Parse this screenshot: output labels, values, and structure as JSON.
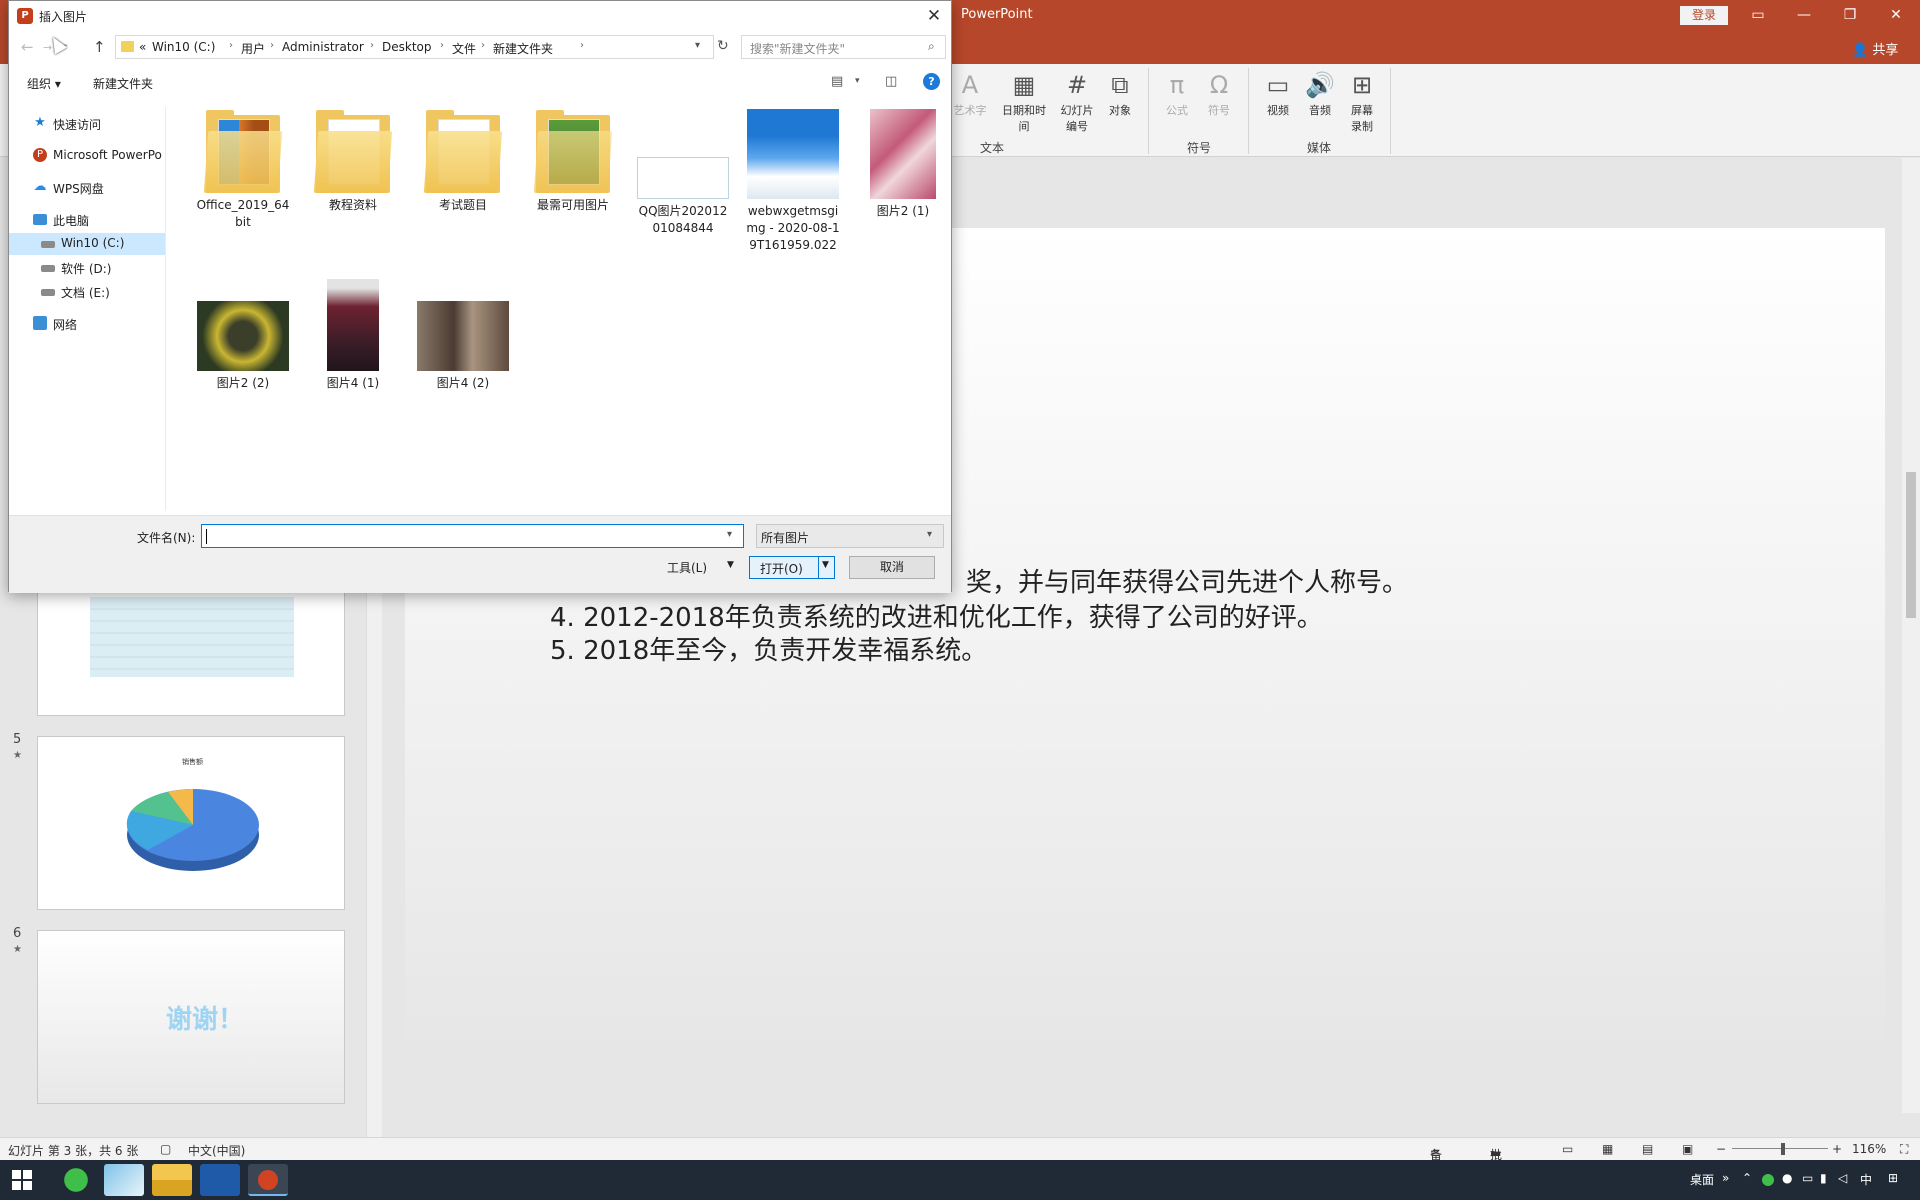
{
  "ppt": {
    "app_title": "PowerPoint",
    "login_label": "登录",
    "share_label": "共享",
    "ribbon": {
      "buttons": [
        {
          "label": "艺术字",
          "icon": "wordart-icon",
          "disabled": true
        },
        {
          "label": "日期和时间",
          "icon": "calendar-icon",
          "disabled": false
        },
        {
          "label": "幻灯片\n编号",
          "icon": "slide-number-icon",
          "disabled": false
        },
        {
          "label": "对象",
          "icon": "object-icon",
          "disabled": false
        },
        {
          "label": "公式",
          "icon": "equation-icon",
          "disabled": true
        },
        {
          "label": "符号",
          "icon": "omega-icon",
          "disabled": true
        },
        {
          "label": "视频",
          "icon": "video-icon",
          "disabled": false
        },
        {
          "label": "音频",
          "icon": "audio-icon",
          "disabled": false
        },
        {
          "label": "屏幕\n录制",
          "icon": "screen-record-icon",
          "disabled": false
        }
      ],
      "groups": [
        "文本",
        "符号",
        "媒体"
      ]
    },
    "thumbnails": [
      {
        "num": "5",
        "chart_title": "销售额"
      },
      {
        "num": "6",
        "text": "谢谢！"
      }
    ],
    "slide_lines": [
      "奖，并与同年获得公司先进个人称号。",
      "4.  2012-2018年负责系统的改进和优化工作，获得了公司的好评。",
      "5.  2018年至今，负责开发幸福系统。"
    ],
    "status": {
      "slide_info": "幻灯片 第 3 张，共 6 张",
      "language": "中文(中国)",
      "notes": "备注",
      "comments": "批注",
      "zoom": "116%"
    }
  },
  "dialog": {
    "title": "插入图片",
    "breadcrumb": [
      "«",
      "Win10 (C:)",
      "用户",
      "Administrator",
      "Desktop",
      "文件",
      "新建文件夹"
    ],
    "search_placeholder": "搜索\"新建文件夹\"",
    "organize_label": "组织 ▾",
    "new_folder_label": "新建文件夹",
    "nav_items": [
      {
        "label": "快速访问",
        "icon": "star-icon",
        "color": "#1d7ad6"
      },
      {
        "label": "Microsoft PowerPo",
        "icon": "powerpoint-icon",
        "color": "#c43e1c"
      },
      {
        "label": "WPS网盘",
        "icon": "cloud-icon",
        "color": "#2b8ae6"
      },
      {
        "label": "此电脑",
        "icon": "computer-icon",
        "color": "#3b8fd6"
      },
      {
        "label": "Win10 (C:)",
        "icon": "drive-icon",
        "color": "#777777"
      },
      {
        "label": "软件 (D:)",
        "icon": "drive-icon",
        "color": "#777777"
      },
      {
        "label": "文档 (E:)",
        "icon": "drive-icon",
        "color": "#777777"
      },
      {
        "label": "网络",
        "icon": "network-icon",
        "color": "#3b8fd6"
      }
    ],
    "files": [
      {
        "name": "Office_2019_64bit",
        "kind": "folder"
      },
      {
        "name": "教程资料",
        "kind": "folder"
      },
      {
        "name": "考试题目",
        "kind": "folder"
      },
      {
        "name": "最需可用图片",
        "kind": "folder"
      },
      {
        "name": "QQ图片20201201084844",
        "kind": "image"
      },
      {
        "name": "webwxgetmsgimg - 2020-08-19T161959.022",
        "kind": "image"
      },
      {
        "name": "图片2 (1)",
        "kind": "image"
      },
      {
        "name": "图片2 (2)",
        "kind": "image"
      },
      {
        "name": "图片4 (1)",
        "kind": "image"
      },
      {
        "name": "图片4 (2)",
        "kind": "image"
      }
    ],
    "filename_label": "文件名(N):",
    "filename_value": "",
    "filetype_value": "所有图片",
    "tools_label": "工具(L)",
    "open_label": "打开(O)",
    "cancel_label": "取消"
  },
  "taskbar": {
    "tray_desktop": "桌面",
    "ime": "中"
  }
}
